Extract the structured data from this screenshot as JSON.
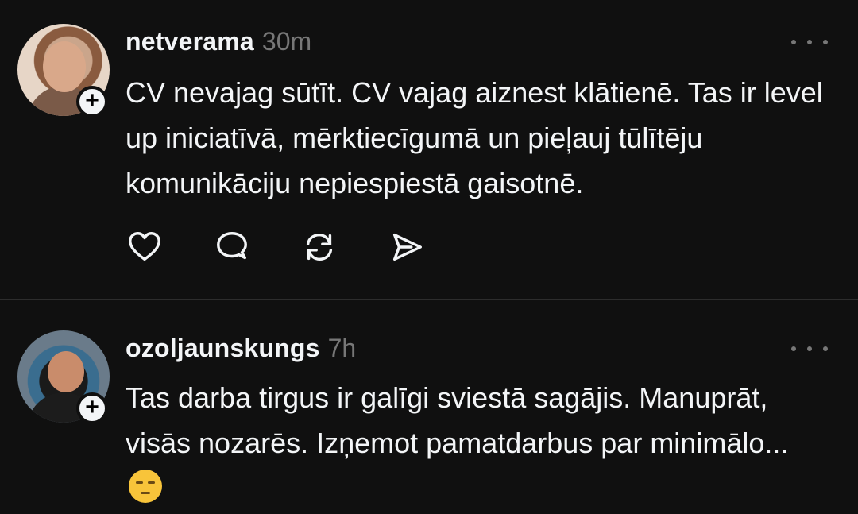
{
  "posts": [
    {
      "username": "netverama",
      "time": "30m",
      "text": "CV nevajag sūtīt. CV vajag aiznest klātienē. Tas ir level up iniciatīvā, mērktiecīgumā un pieļauj tūlītēju komunikāciju nepiespiestā gaisotnē."
    },
    {
      "username": "ozoljaunskungs",
      "time": "7h",
      "text": "Tas darba tirgus ir galīgi sviestā sagājis. Manuprāt, visās nozarēs. Izņemot pamatdarbus par minimālo..."
    }
  ],
  "icons": {
    "follow": "plus-icon",
    "more": "more-horizontal-icon",
    "actions": [
      "heart-icon",
      "comment-icon",
      "repost-icon",
      "share-icon"
    ],
    "emoji": "pensive-face-emoji"
  },
  "colors": {
    "background": "#101010",
    "text": "#f3f5f7",
    "secondary": "#777777",
    "divider": "#2d2d2d"
  }
}
